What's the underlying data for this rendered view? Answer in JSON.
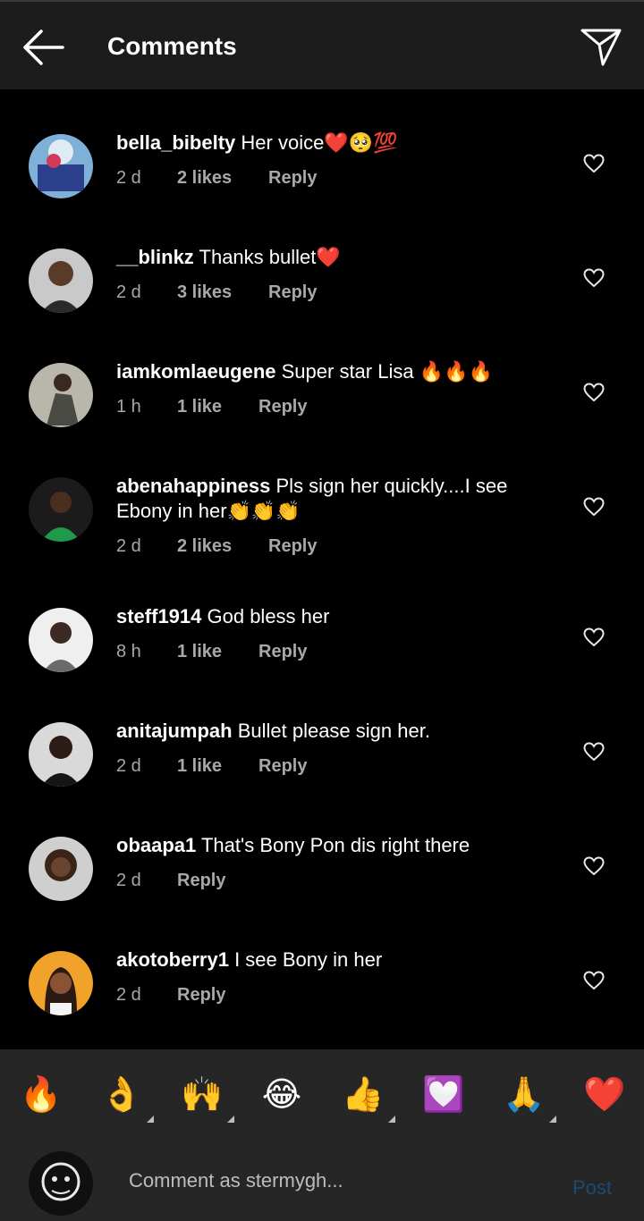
{
  "header": {
    "title": "Comments"
  },
  "comments": [
    {
      "username": "bella_bibelty",
      "text": " Her voice❤️🥺💯",
      "time": "2 d",
      "likes": "2 likes",
      "reply": "Reply"
    },
    {
      "username": "__blinkz",
      "text": " Thanks bullet❤️",
      "time": "2 d",
      "likes": "3 likes",
      "reply": "Reply"
    },
    {
      "username": "iamkomlaeugene",
      "text": " Super star Lisa 🔥🔥🔥",
      "time": "1 h",
      "likes": "1 like",
      "reply": "Reply"
    },
    {
      "username": "abenahappiness",
      "text": " Pls sign her quickly....I see Ebony in her👏👏👏",
      "time": "2 d",
      "likes": "2 likes",
      "reply": "Reply"
    },
    {
      "username": "steff1914",
      "text": " God bless her",
      "time": "8 h",
      "likes": "1 like",
      "reply": "Reply"
    },
    {
      "username": "anitajumpah",
      "text": " Bullet please sign her.",
      "time": "2 d",
      "likes": "1 like",
      "reply": "Reply"
    },
    {
      "username": "obaapa1",
      "text": " That's Bony Pon dis right there",
      "time": "2 d",
      "likes": "",
      "reply": "Reply"
    },
    {
      "username": "akotoberry1",
      "text": " I see Bony in her",
      "time": "2 d",
      "likes": "",
      "reply": "Reply"
    }
  ],
  "emoji_bar": [
    "🔥",
    "👌",
    "🙌",
    "😂",
    "👍",
    "💟",
    "🙏",
    "❤️"
  ],
  "input": {
    "placeholder": "Comment as stermygh...",
    "post_label": "Post"
  },
  "colors": {
    "background": "#000000",
    "header": "#1c1c1c",
    "bar": "#262626",
    "meta": "#a8a8a8",
    "post_disabled": "#1d4a73"
  }
}
